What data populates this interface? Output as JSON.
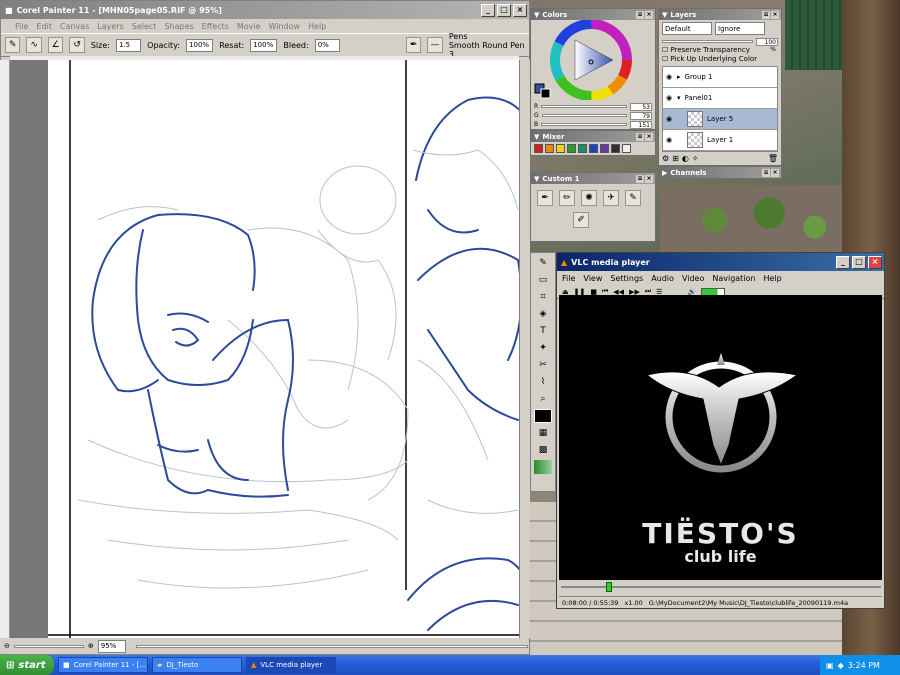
{
  "painter": {
    "title": "Corel Painter 11 - [MHN05page05.RIF @ 95%]",
    "menu": [
      "File",
      "Edit",
      "Canvas",
      "Layers",
      "Select",
      "Shapes",
      "Effects",
      "Movie",
      "Window",
      "Help"
    ],
    "props": {
      "size_label": "Size:",
      "size_value": "1.5",
      "opacity_label": "Opacity:",
      "opacity_value": "100%",
      "resat_label": "Resat:",
      "resat_value": "100%",
      "bleed_label": "Bleed:",
      "bleed_value": "0%",
      "brush_category": "Pens",
      "brush_variant": "Smooth Round Pen 3"
    },
    "zoom": "95%"
  },
  "colors_panel": {
    "title": "Colors",
    "r_label": "R",
    "r_value": "53",
    "g_label": "G",
    "g_value": "79",
    "b_label": "B",
    "b_value": "151",
    "main_color": "#354f97"
  },
  "mixer_panel": {
    "title": "Mixer",
    "swatches": [
      "#d42020",
      "#e88a10",
      "#f2d21a",
      "#2c9a2c",
      "#1a8f6a",
      "#2040c0",
      "#6a3aa0",
      "#303030",
      "#f0f0f0"
    ]
  },
  "custom_panel": {
    "title": "Custom 1"
  },
  "layers_panel": {
    "title": "Layers",
    "composite_method": "Default",
    "composite_depth": "Ignore",
    "opacity_value": "100 %",
    "preserve_transparency": "Preserve Transparency",
    "pick_up_underlying": "Pick Up Underlying Color",
    "layers": [
      {
        "name": "Group 1",
        "selected": false
      },
      {
        "name": "Panel01",
        "selected": false
      },
      {
        "name": "Layer 5",
        "selected": true
      },
      {
        "name": "Layer 1",
        "selected": false
      }
    ]
  },
  "channels_panel": {
    "title": "Channels"
  },
  "vlc": {
    "title": "VLC media player",
    "menu": [
      "File",
      "View",
      "Settings",
      "Audio",
      "Video",
      "Navigation",
      "Help"
    ],
    "logo_line1": "TIËSTO'S",
    "logo_line2": "club life",
    "time": "0:08:00 / 0:55:39",
    "speed": "x1.00",
    "path": "G:\\MyDocument2\\My Music\\DJ_Tiesto\\clublife_20090119.m4a",
    "progress_fraction": 0.144
  },
  "taskbar": {
    "start_label": "start",
    "tasks": [
      "Corel Painter 11 - [...",
      "DJ_Tiesto",
      "VLC media player"
    ],
    "clock": "3:24 PM"
  }
}
